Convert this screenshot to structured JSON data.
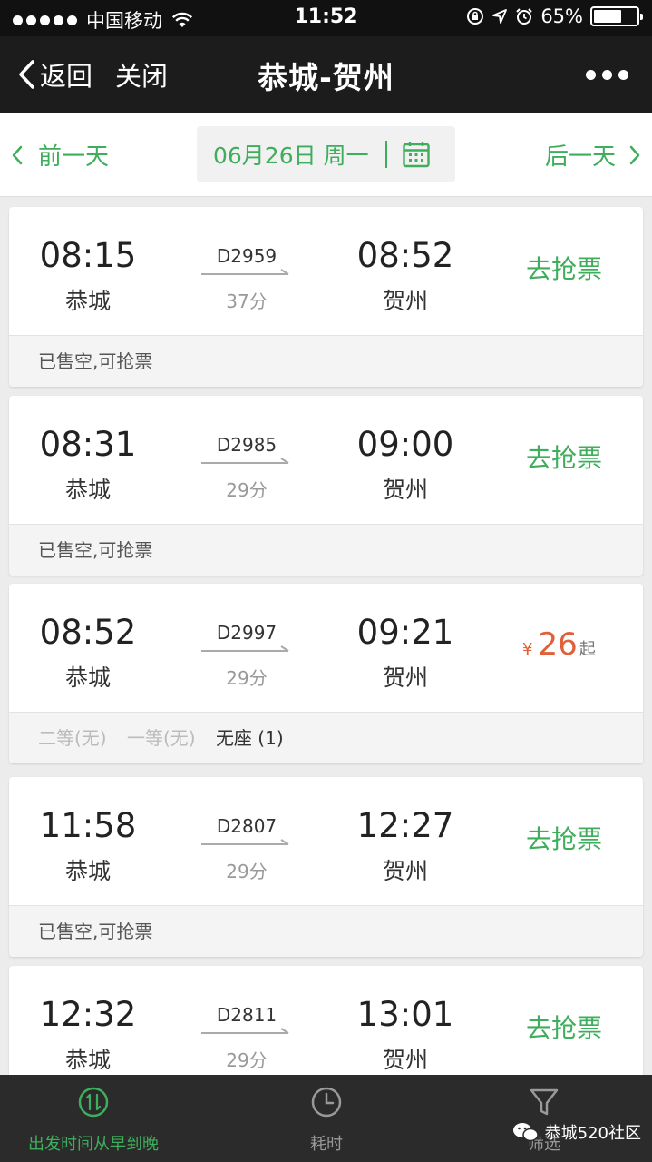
{
  "status_bar": {
    "carrier": "中国移动",
    "time": "11:52",
    "battery": "65%",
    "battery_level": 0.65
  },
  "nav": {
    "back_label": "返回",
    "close_label": "关闭",
    "title": "恭城-贺州"
  },
  "date_bar": {
    "prev_label": "前一天",
    "date_text": "06月26日 周一",
    "next_label": "后一天"
  },
  "trains": [
    {
      "dep_time": "08:15",
      "dep_station": "恭城",
      "train_no": "D2959",
      "duration": "37分",
      "arr_time": "08:52",
      "arr_station": "贺州",
      "action": "去抢票",
      "footer": "已售空,可抢票"
    },
    {
      "dep_time": "08:31",
      "dep_station": "恭城",
      "train_no": "D2985",
      "duration": "29分",
      "arr_time": "09:00",
      "arr_station": "贺州",
      "action": "去抢票",
      "footer": "已售空,可抢票"
    },
    {
      "dep_time": "08:52",
      "dep_station": "恭城",
      "train_no": "D2997",
      "duration": "29分",
      "arr_time": "09:21",
      "arr_station": "贺州",
      "price": {
        "currency": "¥",
        "amount": "26",
        "suffix": "起"
      },
      "seats": [
        {
          "label": "二等(无)",
          "available": false
        },
        {
          "label": "一等(无)",
          "available": false
        },
        {
          "label": "无座 (1)",
          "available": true
        }
      ]
    },
    {
      "dep_time": "11:58",
      "dep_station": "恭城",
      "train_no": "D2807",
      "duration": "29分",
      "arr_time": "12:27",
      "arr_station": "贺州",
      "action": "去抢票",
      "footer": "已售空,可抢票"
    },
    {
      "dep_time": "12:32",
      "dep_station": "恭城",
      "train_no": "D2811",
      "duration": "29分",
      "arr_time": "13:01",
      "arr_station": "贺州",
      "action": "去抢票"
    }
  ],
  "tab_bar": {
    "tabs": [
      {
        "label": "出发时间从早到晚",
        "icon": "sort-time-icon",
        "active": true
      },
      {
        "label": "耗时",
        "icon": "clock-icon",
        "active": false
      },
      {
        "label": "筛选",
        "icon": "filter-icon",
        "active": false
      }
    ]
  },
  "watermark": "恭城520社区",
  "colors": {
    "accent_green": "#3fae5c",
    "price_orange": "#e0603a",
    "nav_bg": "#1c1c1c",
    "tab_bg": "#2b2b2b"
  }
}
